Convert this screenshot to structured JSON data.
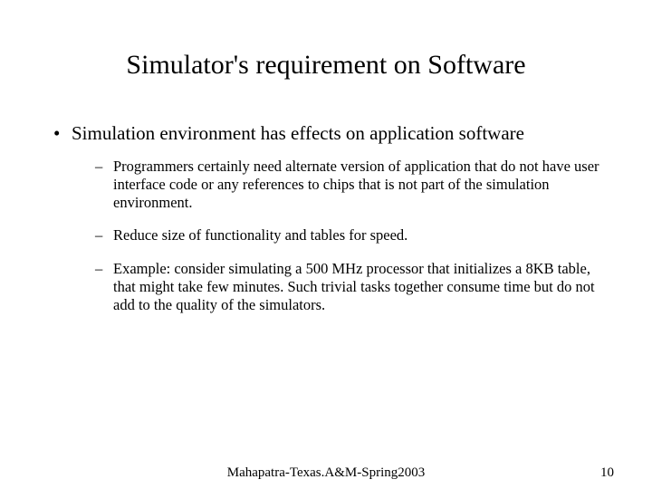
{
  "title": "Simulator's requirement on Software",
  "bullets": {
    "main": "Simulation environment has effects on application software",
    "subs": [
      "Programmers certainly need alternate version of application that do not have user interface code or any references to chips that is not part of the simulation environment.",
      "Reduce size of functionality and tables for speed.",
      "Example: consider simulating a 500 MHz processor that initializes a 8KB table, that might take few minutes. Such trivial tasks together consume time but do not add to the quality of the simulators."
    ]
  },
  "footer": {
    "center": "Mahapatra-Texas.A&M-Spring2003",
    "page": "10"
  }
}
